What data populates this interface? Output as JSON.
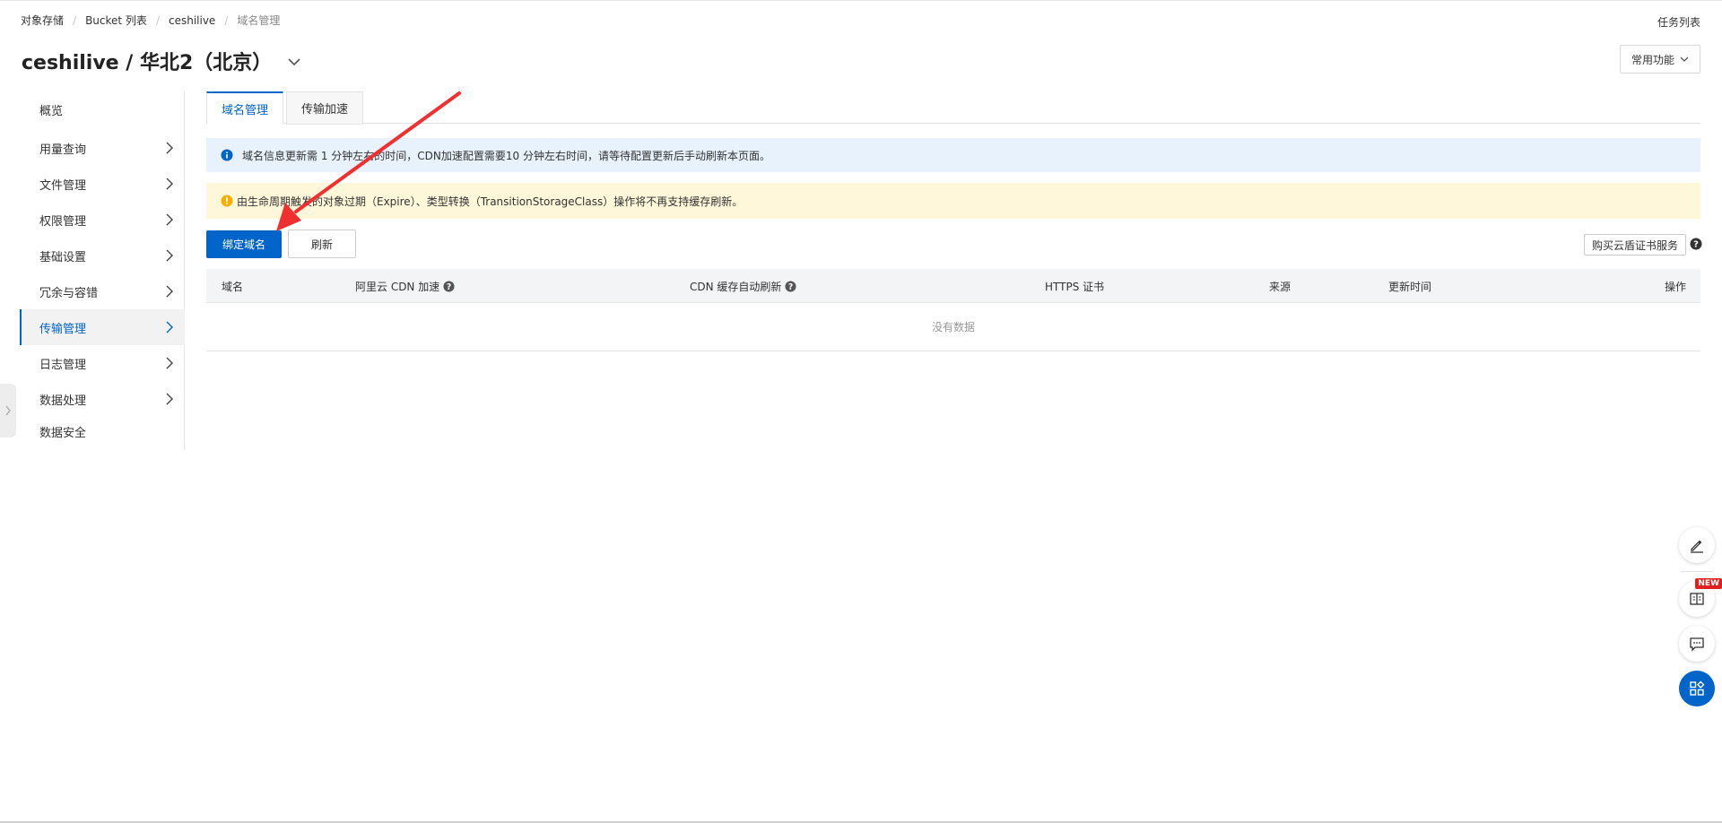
{
  "breadcrumb": {
    "items": [
      "对象存储",
      "Bucket 列表",
      "ceshilive",
      "域名管理"
    ],
    "separator": "/"
  },
  "header": {
    "task_list": "任务列表",
    "title": "ceshilive / 华北2（北京）",
    "common_functions": "常用功能"
  },
  "sidebar": {
    "items": [
      {
        "label": "概览"
      },
      {
        "label": "用量查询"
      },
      {
        "label": "文件管理"
      },
      {
        "label": "权限管理"
      },
      {
        "label": "基础设置"
      },
      {
        "label": "冗余与容错"
      },
      {
        "label": "传输管理"
      },
      {
        "label": "日志管理"
      },
      {
        "label": "数据处理"
      },
      {
        "label": "数据安全"
      }
    ]
  },
  "tabs": [
    "域名管理",
    "传输加速"
  ],
  "notices": {
    "info": "域名信息更新需 1 分钟左右的时间，CDN加速配置需要10 分钟左右时间，请等待配置更新后手动刷新本页面。",
    "warn": "由生命周期触发的对象过期（Expire）、类型转换（TransitionStorageClass）操作将不再支持缓存刷新。"
  },
  "toolbar": {
    "bind_domain": "绑定域名",
    "refresh": "刷新",
    "buy_cert": "购买云盾证书服务"
  },
  "table": {
    "columns": [
      "域名",
      "阿里云 CDN 加速",
      "CDN 缓存自动刷新",
      "HTTPS 证书",
      "来源",
      "更新时间",
      "操作"
    ],
    "empty_text": "没有数据"
  },
  "floating_tools": {
    "new_badge": "NEW"
  },
  "colors": {
    "accent": "#0064c8",
    "info_bg": "#e7f2fc",
    "warn_bg": "#fff7d9",
    "warn_icon": "#f5b000",
    "annotation_arrow": "#f03030"
  }
}
